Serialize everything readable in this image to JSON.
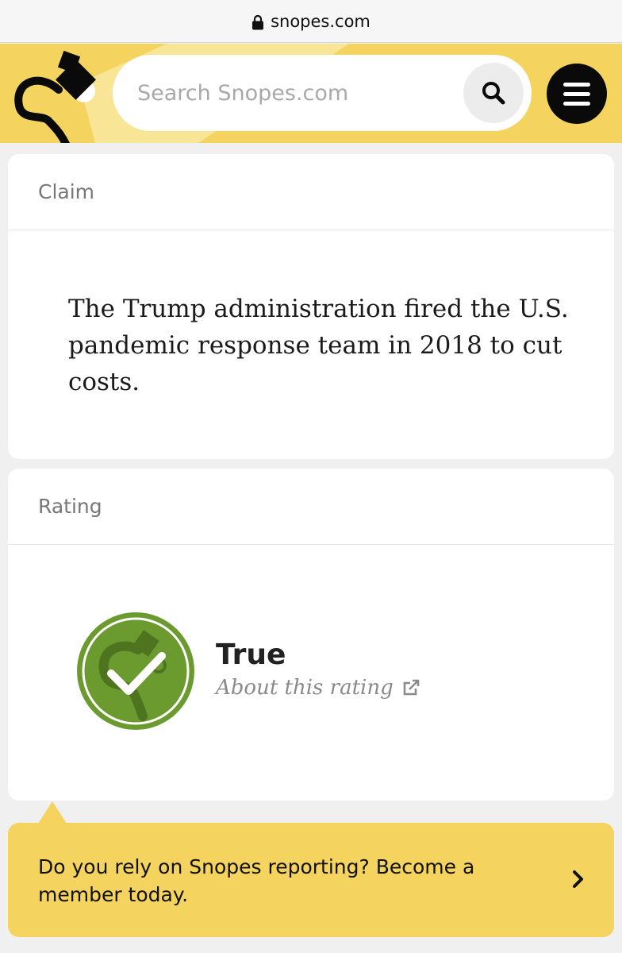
{
  "browser": {
    "url": "snopes.com",
    "lock_icon": "lock-icon"
  },
  "header": {
    "logo": "snopes-spotlight-logo",
    "search": {
      "placeholder": "Search Snopes.com",
      "value": "",
      "button_icon": "search-icon"
    },
    "menu_icon": "hamburger-menu-icon",
    "brand_color": "#f4d35e"
  },
  "claim": {
    "heading": "Claim",
    "text": "The Trump administration fired the U.S. pandemic response team in 2018 to cut costs."
  },
  "rating": {
    "heading": "Rating",
    "value": "True",
    "badge_icon": "true-checkmark-badge-icon",
    "badge_color": "#6b9a2f",
    "about_link": "About this rating",
    "about_icon": "external-link-icon"
  },
  "cta": {
    "text": "Do you rely on Snopes reporting? Become a member today.",
    "arrow_icon": "chevron-right-icon"
  }
}
